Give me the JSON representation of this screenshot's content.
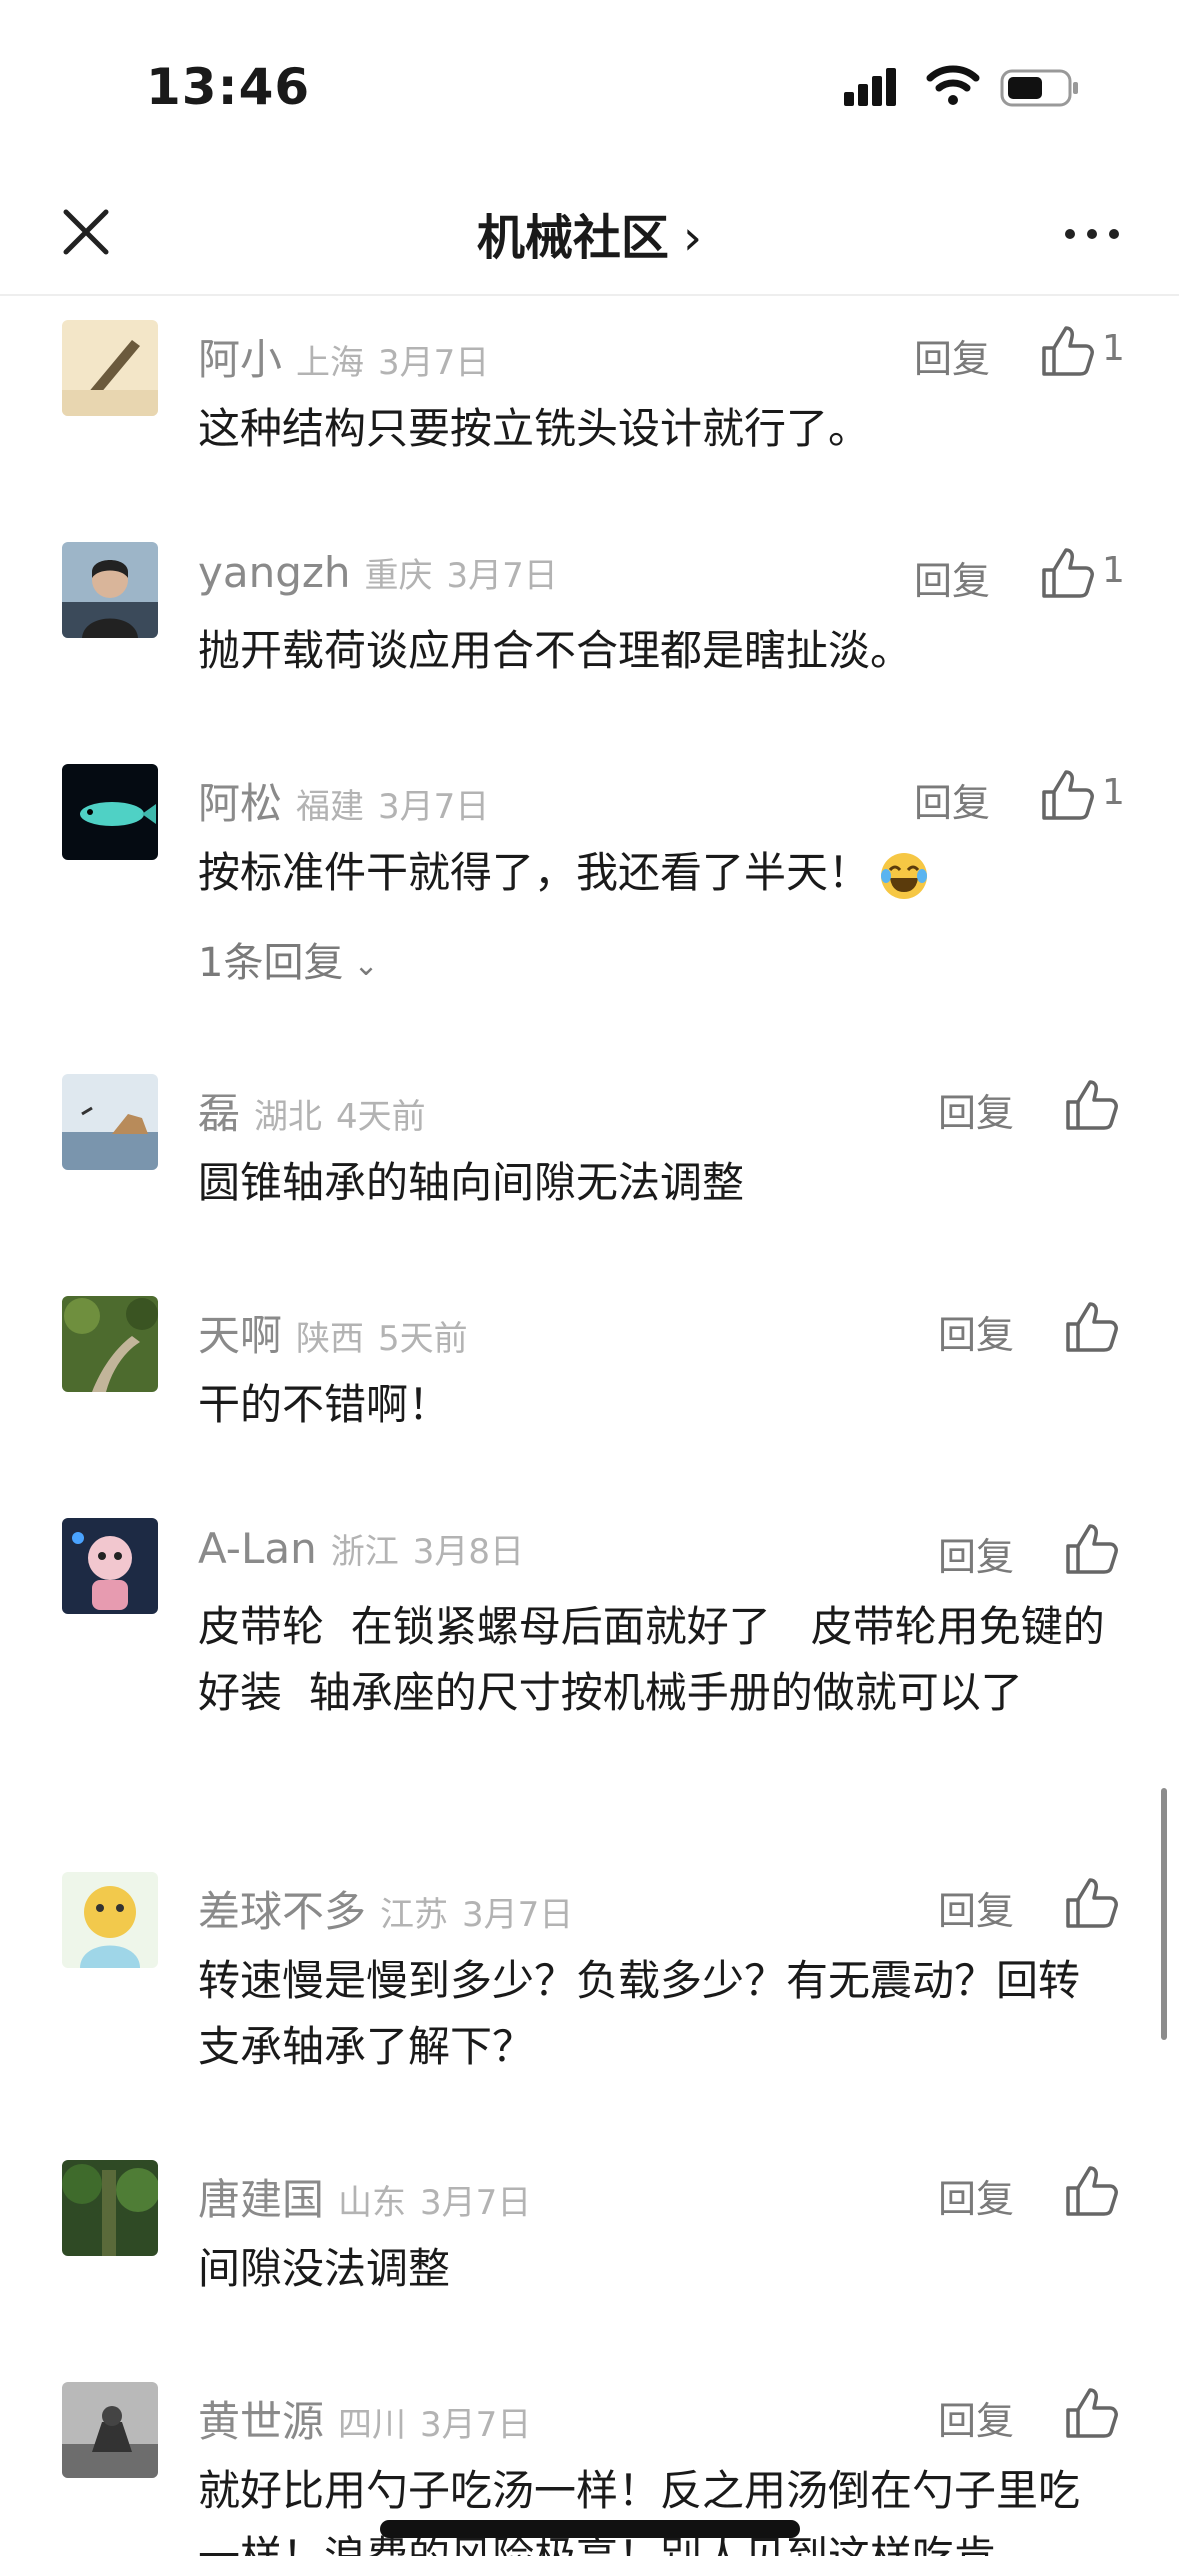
{
  "status": {
    "time": "13:46"
  },
  "nav": {
    "title": "机械社区",
    "chevron": "›"
  },
  "reply_label": "回复",
  "icons": {
    "close": "close-icon",
    "more": "more-icon",
    "like": "thumbs-up-icon",
    "signal": "cellular-signal-icon",
    "wifi": "wifi-icon",
    "battery": "battery-icon"
  },
  "comments": [
    {
      "name": "阿小",
      "loc": "上海",
      "date": "3月7日",
      "likes": "1",
      "text": "这种结构只要按立铣头设计就行了。"
    },
    {
      "name": "yangzh",
      "loc": "重庆",
      "date": "3月7日",
      "likes": "1",
      "text": "抛开载荷谈应用合不合理都是瞎扯淡。"
    },
    {
      "name": "阿松",
      "loc": "福建",
      "date": "3月7日",
      "likes": "1",
      "text": "按标准件干就得了，我还看了半天！",
      "emoji": "laughing-tears-emoji",
      "subreplies": "1条回复"
    },
    {
      "name": "磊",
      "loc": "湖北",
      "date": "4天前",
      "likes": "",
      "text": "圆锥轴承的轴向间隙无法调整"
    },
    {
      "name": "天啊",
      "loc": "陕西",
      "date": "5天前",
      "likes": "",
      "text": "干的不错啊！"
    },
    {
      "name": "A-Lan",
      "loc": "浙江",
      "date": "3月8日",
      "likes": "",
      "text": "皮带轮  在锁紧螺母后面就好了   皮带轮用免键的好装  轴承座的尺寸按机械手册的做就可以了"
    },
    {
      "name": "差球不多",
      "loc": "江苏",
      "date": "3月7日",
      "likes": "",
      "text": "转速慢是慢到多少？负载多少？有无震动？回转支承轴承了解下？"
    },
    {
      "name": "唐建国",
      "loc": "山东",
      "date": "3月7日",
      "likes": "",
      "text": "间隙没法调整"
    },
    {
      "name": "黄世源",
      "loc": "四川",
      "date": "3月7日",
      "likes": "",
      "text": "就好比用勺子吃汤一样！反之用汤倒在勺子里吃一样！浪费的风险极高！别人见到这样吃肯"
    }
  ]
}
